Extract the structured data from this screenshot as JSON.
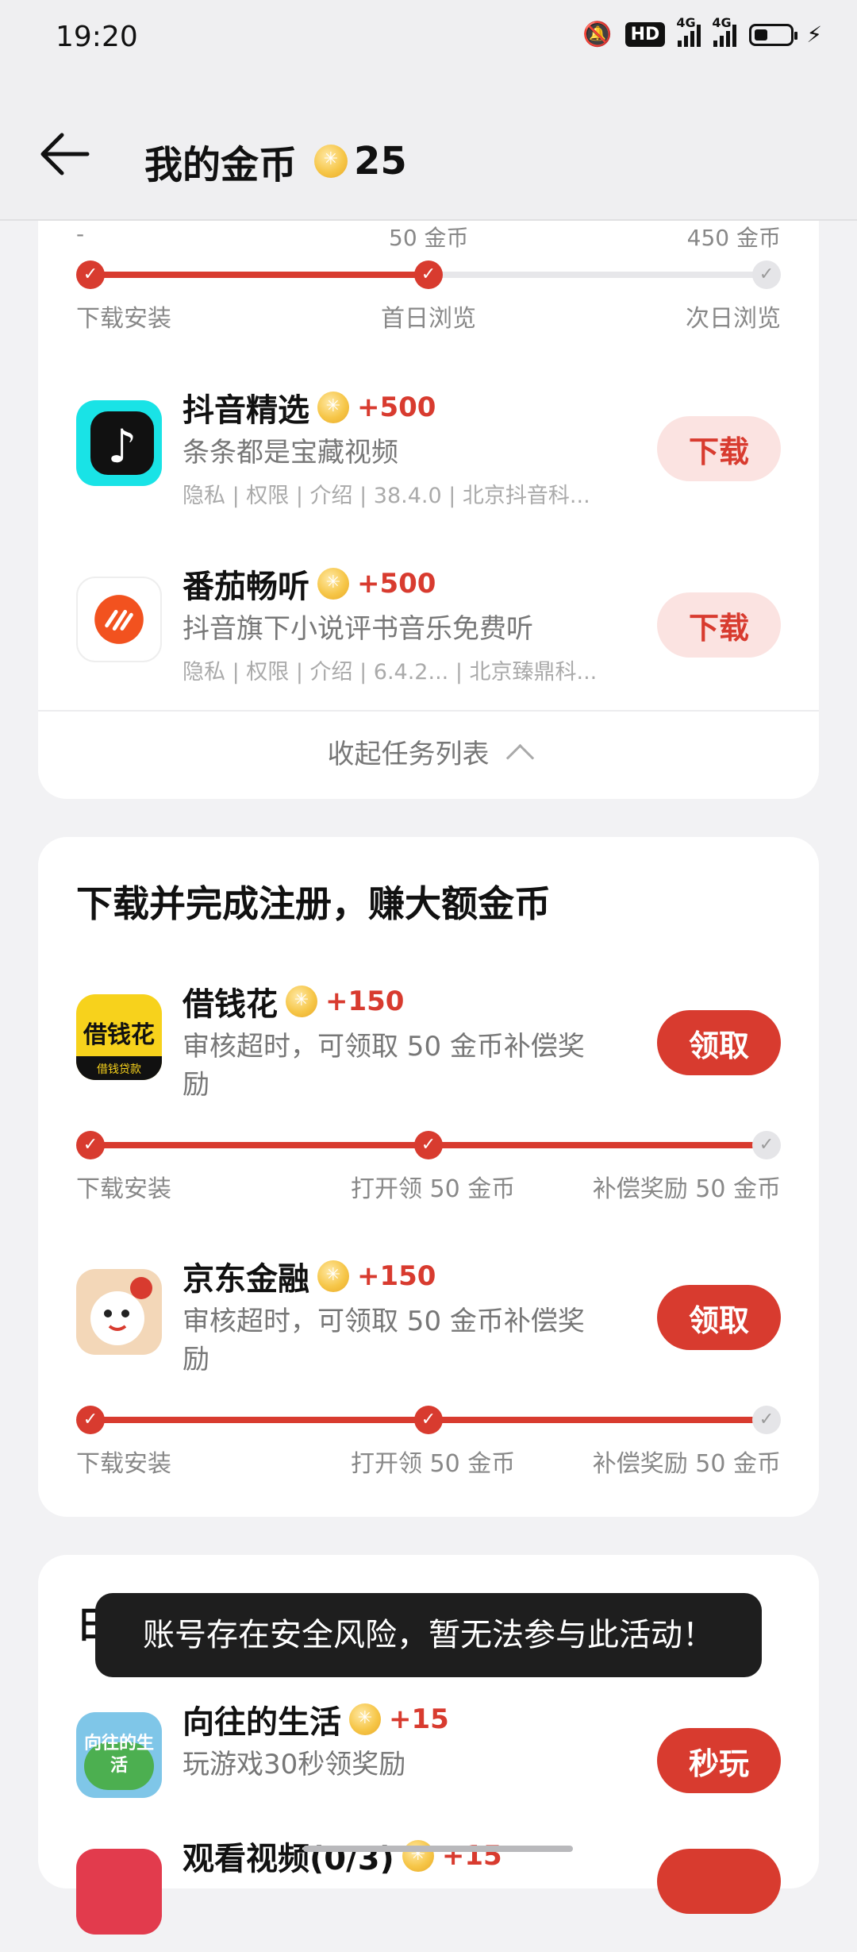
{
  "status_bar": {
    "time": "19:20",
    "hd_label": "HD",
    "net1": "4G",
    "net2": "4G"
  },
  "header": {
    "title": "我的金币",
    "coin_total": "25"
  },
  "card1": {
    "progress": {
      "top_labels": [
        "-",
        "50 金币",
        "450 金币"
      ],
      "steps": [
        "下载安装",
        "首日浏览",
        "次日浏览"
      ],
      "completed_fraction": 0.5
    },
    "apps": [
      {
        "name": "抖音精选",
        "bonus": "+500",
        "desc": "条条都是宝藏视频",
        "meta": "隐私 | 权限 | 介绍 | 38.4.0  | 北京抖音科...",
        "button": "下载",
        "icon": "douyin-jingxuan-icon"
      },
      {
        "name": "番茄畅听",
        "bonus": "+500",
        "desc": "抖音旗下小说评书音乐免费听",
        "meta": "隐私 | 权限 | 介绍 | 6.4.2...  | 北京臻鼎科...",
        "button": "下载",
        "icon": "fanqie-changting-icon"
      }
    ],
    "collapse_label": "收起任务列表"
  },
  "card2": {
    "title": "下载并完成注册，赚大额金币",
    "apps": [
      {
        "name": "借钱花",
        "bonus": "+150",
        "desc": "审核超时，可领取 50 金币补偿奖励",
        "button": "领取",
        "icon_text": "借钱花",
        "icon_sub": "借钱贷款",
        "progress": {
          "steps": [
            "下载安装",
            "打开领 50 金币",
            "补偿奖励 50 金币"
          ],
          "completed_fraction": 1.0
        }
      },
      {
        "name": "京东金融",
        "bonus": "+150",
        "desc": "审核超时，可领取 50 金币补偿奖励",
        "button": "领取",
        "icon": "jd-finance-icon",
        "progress": {
          "steps": [
            "下载安装",
            "打开领 50 金币",
            "补偿奖励 50 金币"
          ],
          "completed_fraction": 1.0
        }
      }
    ]
  },
  "card3": {
    "title_partial": "日",
    "apps": [
      {
        "name": "向往的生活",
        "bonus": "+15",
        "desc": "玩游戏30秒领奖励",
        "button": "秒玩",
        "icon_text": "向往的生活"
      },
      {
        "name": "观看视频(0/3)",
        "bonus": "+15"
      }
    ]
  },
  "toast": "账号存在安全风险，暂无法参与此活动！",
  "colors": {
    "accent": "#d83b2f",
    "soft_accent": "#fbe3e1",
    "background": "#f2f2f4"
  }
}
